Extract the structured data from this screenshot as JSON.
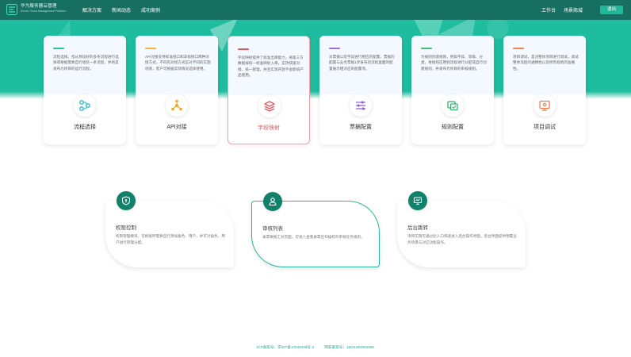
{
  "header": {
    "brand_name": "华为服务器云管理",
    "brand_sub": "Server Cloud Management Platform",
    "nav": [
      "解决方案",
      "新闻动态",
      "成功案例"
    ],
    "nav_right": [
      "工作台",
      "场景商城"
    ],
    "logout_label": "退出"
  },
  "cards": [
    {
      "title": "流程选择",
      "desc": "流程选择。指从预设好的多条流程进行选择或根据需要自行组装一条流程，并将其发布为项目的运行流程。",
      "icon": "flow-icon",
      "line_color": "#2bc4a0",
      "icon_color": "#2bb8c9"
    },
    {
      "title": "API对接",
      "desc": "API对接支持标准接口和非标接口两种对接方式，不同的对接方式应对不同的实施场景，客户可根据实际情况选择使用。",
      "icon": "api-icon",
      "line_color": "#f3b341",
      "icon_color": "#f0a828"
    },
    {
      "title": "字段映射",
      "desc": "字段映射提供了标准出库能力，将第三方数据按统一标准映射入库，支持快速对接、统一管理，并且实现开放不会影响产品使用。",
      "icon": "layers-icon",
      "line_color": "#e8575e",
      "icon_color": "#e8575e"
    },
    {
      "title": "票据配置",
      "desc": "对票据以及字段进行相应的配置，票据的配置与业务票据1步发布的流程里面的配置展示相对应的配置项。",
      "icon": "sliders-icon",
      "line_color": "#9b6be3",
      "icon_color": "#8a5fd8"
    },
    {
      "title": "规则配置",
      "desc": "为规则创建规则，例如字段、等级、分类，将规则应用到流程进行分配或自行创建规则，并发布为项目的审核规则。",
      "icon": "rule-icon",
      "line_color": "#3fc27c",
      "icon_color": "#32b36c"
    },
    {
      "title": "项目调试",
      "desc": "项目调试，是对整体项目进行调试，调试整体流程的通畅性以及所有规则的准确性。",
      "icon": "debug-icon",
      "line_color": "#f0845a",
      "icon_color": "#ef7d54"
    }
  ],
  "features": [
    {
      "title": "权限控制",
      "desc": "权限管理模块，可根据所需要自行添加角色、用户，并可对角色、用户进行管理分配。",
      "icon": "shield-icon"
    },
    {
      "title": "审核列表",
      "desc": "录票数据汇总页面，可进入查看录票在扫描校的审核任务规则。",
      "icon": "user-icon"
    },
    {
      "title": "后台跳转",
      "desc": "项目实施可通过此入口快速进入后台操作界面，后台界面提供预置业务场景与对应功能操作。",
      "icon": "monitor-icon"
    }
  ],
  "footer": {
    "icp": "ICP备案号：京ICP备17043438号-2",
    "police": "网安备案号：11011202001955"
  },
  "colors": {
    "primary": "#176f62",
    "hero": "#1ebd9f",
    "accent": "#e8575e"
  }
}
